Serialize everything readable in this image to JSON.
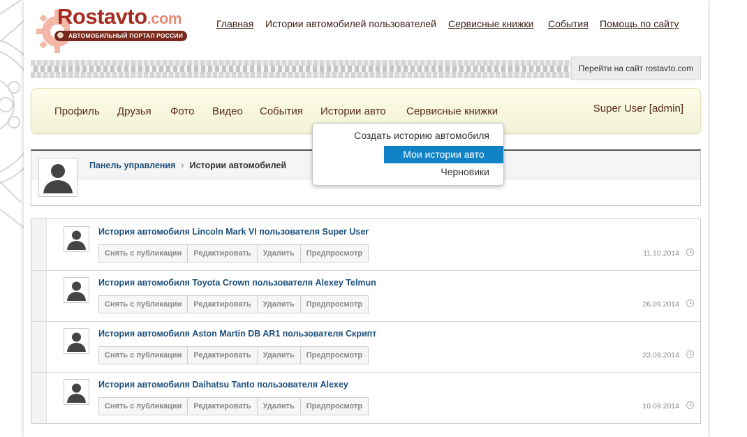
{
  "logo": {
    "name": "Rostavto",
    "domain": ".com",
    "tagline": "АВТОМОБИЛЬНЫЙ ПОРТАЛ РОССИИ"
  },
  "topnav": [
    {
      "label": "Главная"
    },
    {
      "label": "Истории автомобилей пользователей"
    },
    {
      "label": "Сервисные книжки"
    },
    {
      "label": "События"
    },
    {
      "label": "Помощь по сайту"
    }
  ],
  "goto_site": "Перейти на сайт rostavto.com",
  "mainmenu": {
    "items": [
      {
        "label": "Профиль"
      },
      {
        "label": "Друзья"
      },
      {
        "label": "Фото"
      },
      {
        "label": "Видео"
      },
      {
        "label": "События"
      },
      {
        "label": "Истории авто"
      },
      {
        "label": "Сервисные книжки"
      }
    ],
    "user": "Super User [admin]"
  },
  "dropdown": {
    "items": [
      {
        "label": "Создать историю автомобиля",
        "active": false
      },
      {
        "label": "Мои истории авто",
        "active": true
      },
      {
        "label": "Черновики",
        "active": false
      }
    ],
    "active_bg": "#0f83c6"
  },
  "breadcrumb": {
    "root": "Панель управления",
    "current": "Истории автомобилей"
  },
  "actions": {
    "unpublish": "Снять с публикации",
    "edit": "Редактировать",
    "delete": "Удалить",
    "preview": "Предпросмотр"
  },
  "stories": [
    {
      "title": "История автомобиля Lincoln Mark VI пользователя Super User",
      "date": "11.10.2014"
    },
    {
      "title": "История автомобиля Toyota Crown пользователя Alexey Telmun",
      "date": "26.09.2014"
    },
    {
      "title": "История автомобиля Aston Martin DB AR1 пользователя Скрипт",
      "date": "23.09.2014"
    },
    {
      "title": "История автомобиля Daihatsu Tanto пользователя Alexey",
      "date": "10.09.2014"
    }
  ],
  "colors": {
    "brand": "#a52b1f",
    "link": "#1c4f7c",
    "menu_text": "#5a2a16"
  }
}
